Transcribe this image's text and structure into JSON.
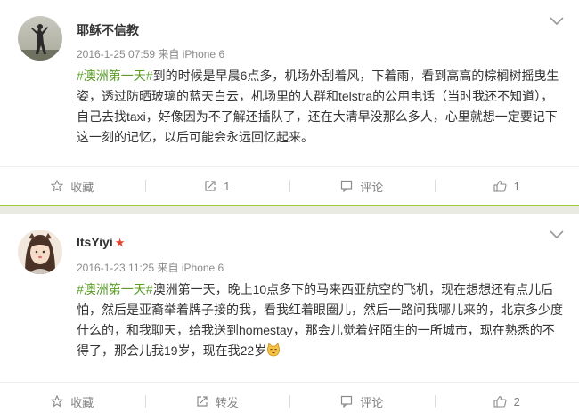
{
  "posts": [
    {
      "username": "耶稣不信教",
      "meta": "2016-1-25 07:59 来自 iPhone 6",
      "tag": "#澳洲第一天#",
      "text": "到的时候是早晨6点多，机场外刮着风，下着雨，看到高高的棕榈树摇曳生姿，透过防晒玻璃的蓝天白云，机场里的人群和telstra的公用电话（当时我还不知道），自己去找taxi，好像因为不了解还插队了，还在大清早没那么多人，心里就想一定要记下这一刻的记忆，以后可能会永远回忆起来。",
      "actions": {
        "favorite": "收藏",
        "repost": "1",
        "comment": "评论",
        "like": "1"
      }
    },
    {
      "username": "ItsYiyi",
      "badge": "★",
      "meta": "2016-1-23 11:25 来自 iPhone 6",
      "tag": "#澳洲第一天#",
      "text": "澳洲第一天，晚上10点多下的马来西亚航空的飞机，现在想想还有点儿后怕，然后是亚裔举着牌子接的我，看我红着眼圈儿，然后一路问我哪儿来的，北京多少度什么的，和我聊天，给我送到homestay，那会儿觉着好陌生的一所城市，现在熟悉的不得了，那会儿我19岁，现在我22岁",
      "actions": {
        "favorite": "收藏",
        "repost": "转发",
        "comment": "评论",
        "like": "2"
      }
    }
  ],
  "colors": {
    "tag_green": "#5a9c25",
    "divider_green": "#9ccd3a",
    "badge_red": "#e8412c"
  }
}
